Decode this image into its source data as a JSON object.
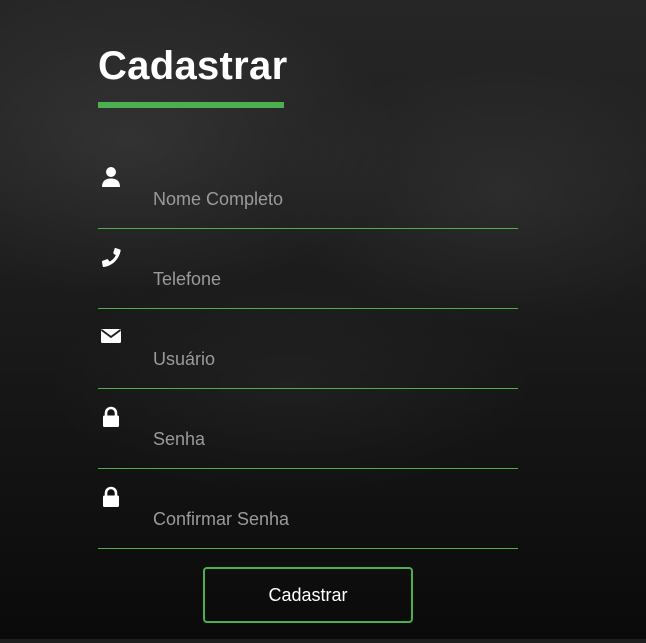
{
  "form": {
    "title": "Cadastrar",
    "fields": [
      {
        "icon": "user-icon",
        "placeholder": "Nome Completo"
      },
      {
        "icon": "phone-icon",
        "placeholder": "Telefone"
      },
      {
        "icon": "envelope-icon",
        "placeholder": "Usuário"
      },
      {
        "icon": "lock-icon",
        "placeholder": "Senha"
      },
      {
        "icon": "lock-icon",
        "placeholder": "Confirmar Senha"
      }
    ],
    "submit_label": "Cadastrar"
  },
  "colors": {
    "accent": "#4caf50",
    "text": "#ffffff",
    "placeholder": "#9a9a9a",
    "background": "#1d1d1d"
  }
}
